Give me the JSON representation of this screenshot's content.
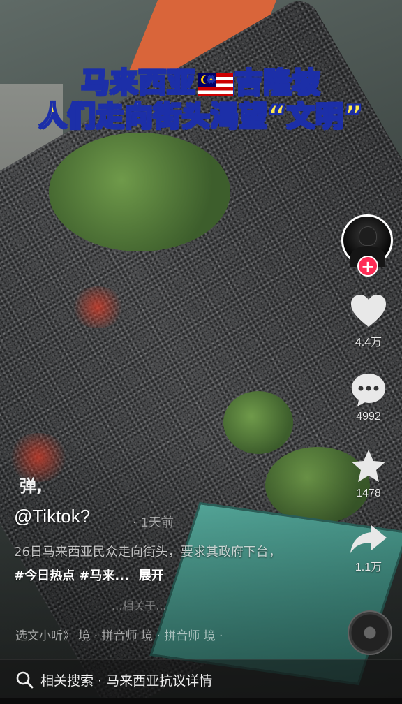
{
  "headline": {
    "line1_left": "马来西亚",
    "line1_right": "吉隆坡",
    "line2": "人们走向街头渴望“文明”"
  },
  "actions": {
    "likes": "4.4万",
    "comments": "4992",
    "favorites": "1478",
    "shares": "1.1万",
    "follow_symbol": "+"
  },
  "post": {
    "watermark": "弹,",
    "username": "@Tiktok?",
    "time": "· 1天前",
    "description": "26日马来西亚民众走向街头，要求其政府下台，",
    "hashtags": "#今日热点 #马来...",
    "expand": "展开",
    "subline": "...相关于..."
  },
  "music": {
    "text": "选文小听》 境 · 拼音师  境 · 拼音师  境 ·"
  },
  "search": {
    "label": "相关搜索 · 马来西亚抗议详情"
  },
  "colors": {
    "headline_fill": "#ffe94a",
    "headline_stroke": "#1c2fa8",
    "follow": "#fe2c55"
  }
}
